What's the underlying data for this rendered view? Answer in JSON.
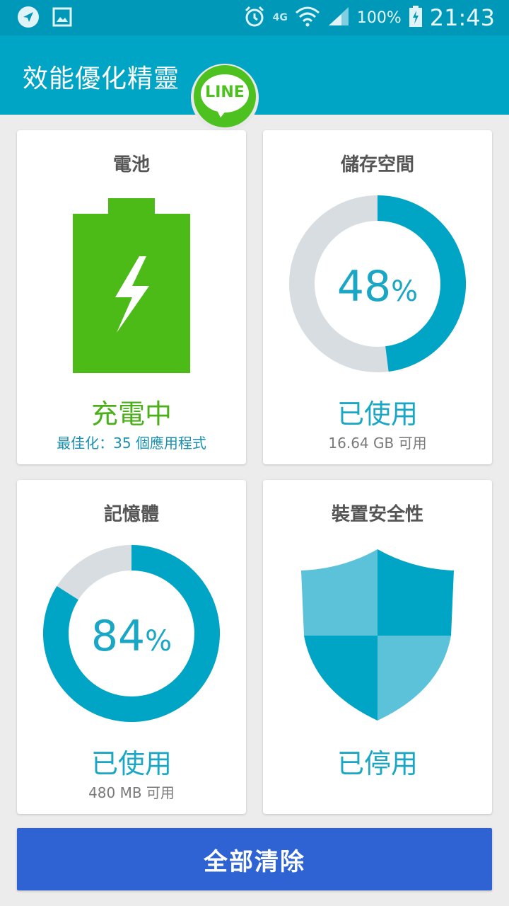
{
  "status_bar": {
    "network": "4G",
    "battery_percent": "100%",
    "time": "21:43"
  },
  "app": {
    "title": "效能優化精靈",
    "badge_text": "LINE"
  },
  "cards": {
    "battery": {
      "title": "電池",
      "status": "充電中",
      "subtitle": "最佳化：35 個應用程式"
    },
    "storage": {
      "title": "儲存空間",
      "percent_value": "48",
      "percent_sign": "%",
      "used_fraction": 0.48,
      "status": "已使用",
      "subtitle": "16.64 GB 可用"
    },
    "memory": {
      "title": "記憶體",
      "percent_value": "84",
      "percent_sign": "%",
      "used_fraction": 0.84,
      "status": "已使用",
      "subtitle": "480 MB 可用"
    },
    "security": {
      "title": "裝置安全性",
      "status": "已停用"
    }
  },
  "action": {
    "clear_all_label": "全部清除"
  },
  "colors": {
    "accent": "#00a4c4",
    "ring_used": "#00a4c4",
    "ring_free": "#d7dde0",
    "battery_green": "#4cbb17",
    "button_blue": "#2f63d4"
  }
}
